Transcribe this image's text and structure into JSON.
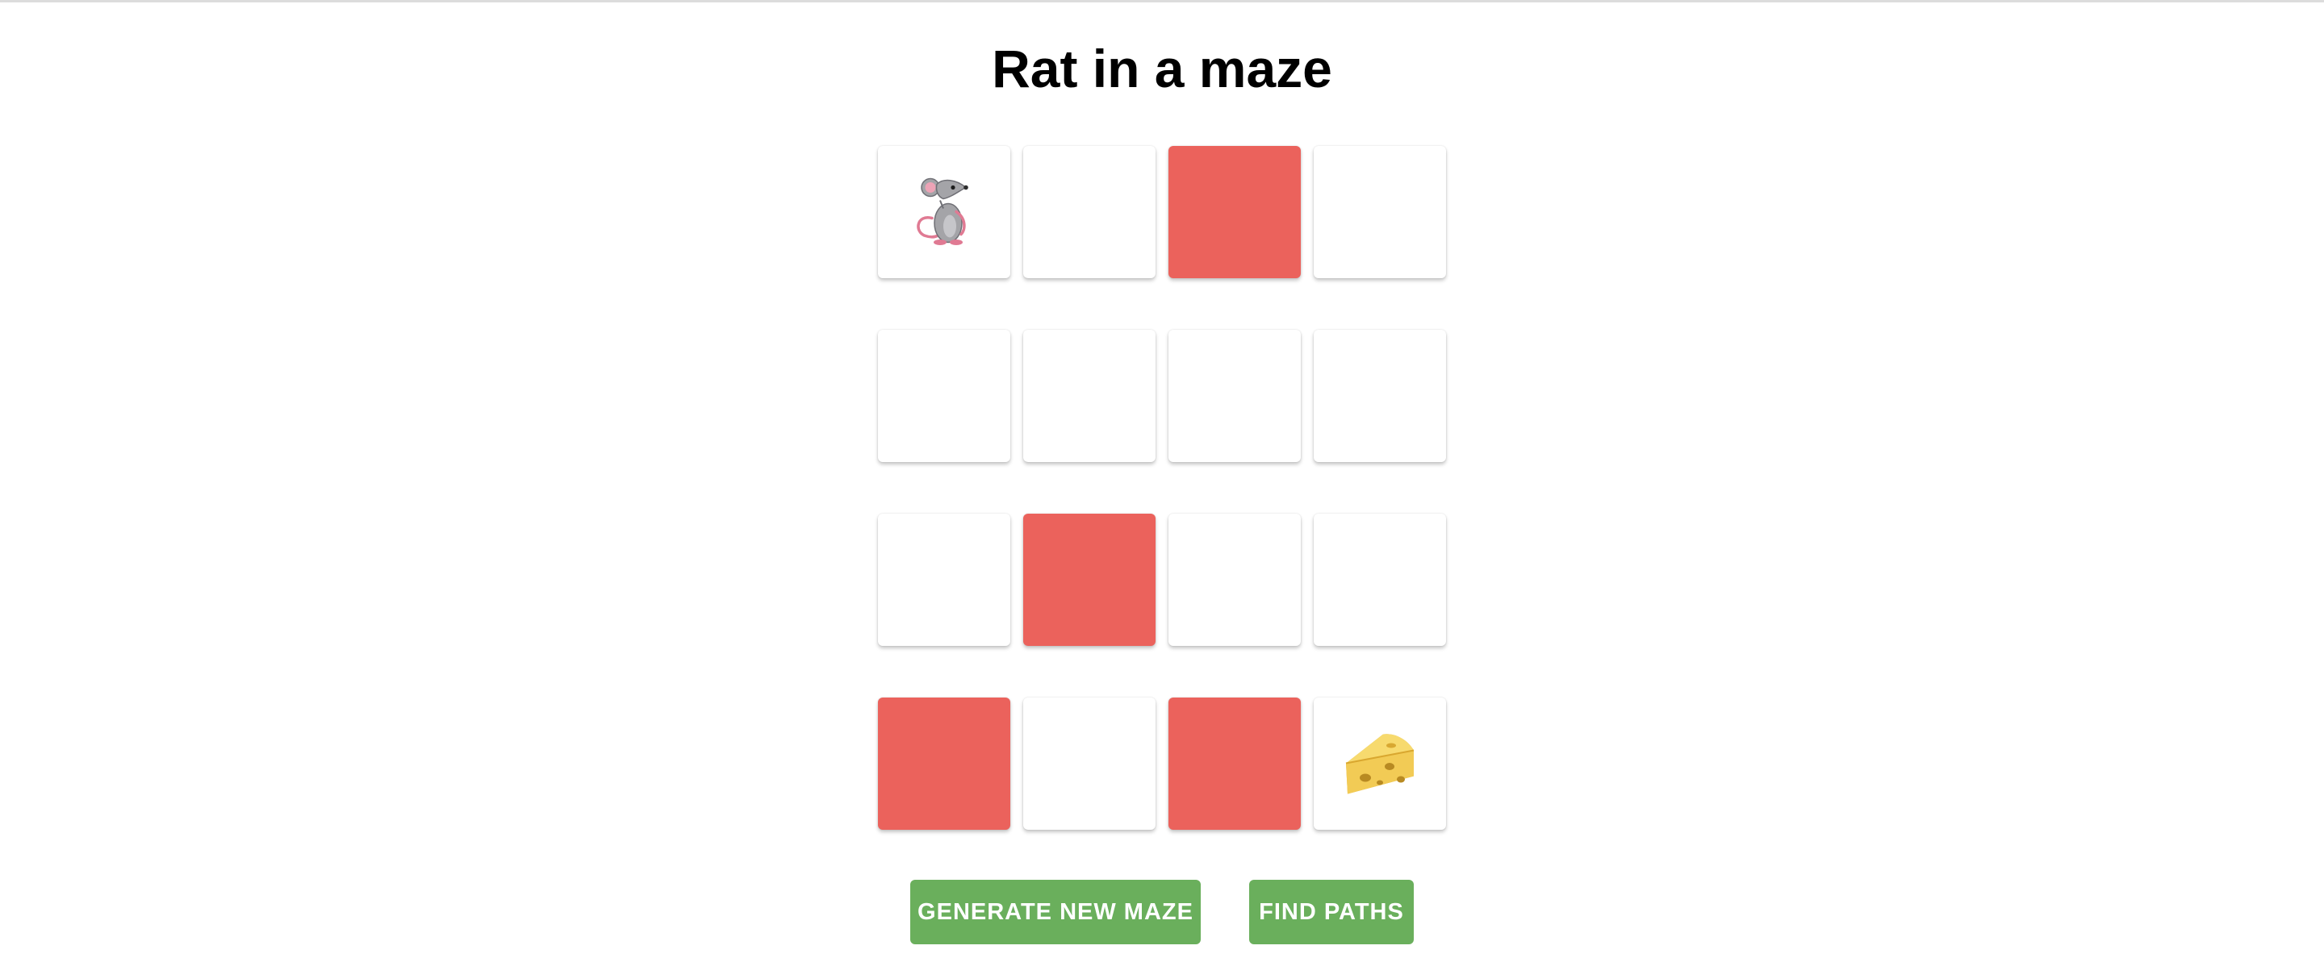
{
  "title": "Rat in a maze",
  "maze": {
    "rows": 4,
    "cols": 4,
    "cells": [
      [
        "rat",
        "open",
        "wall",
        "open"
      ],
      [
        "open",
        "open",
        "open",
        "open"
      ],
      [
        "open",
        "wall",
        "open",
        "open"
      ],
      [
        "wall",
        "open",
        "wall",
        "cheese"
      ]
    ],
    "start_icon": "rat-icon",
    "goal_icon": "cheese-icon"
  },
  "colors": {
    "wall": "#eb625c",
    "open": "#ffffff",
    "button": "#6aaf5c"
  },
  "buttons": {
    "generate_label": "GENERATE NEW MAZE",
    "find_label": "FIND PATHS"
  }
}
